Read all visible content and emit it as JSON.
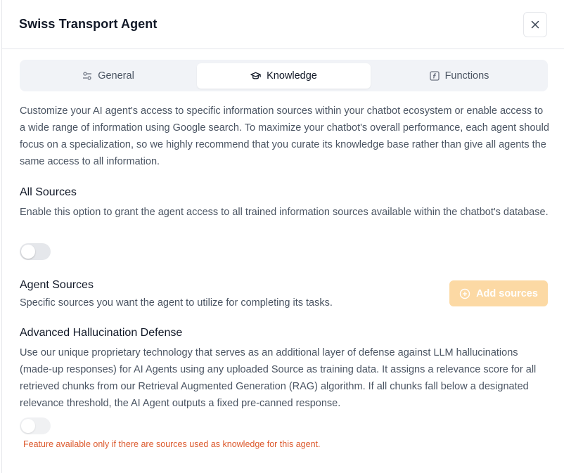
{
  "dialog": {
    "title": "Swiss Transport Agent",
    "close_icon": "close-icon"
  },
  "tabs": [
    {
      "label": "General",
      "icon": "sliders-icon",
      "active": false
    },
    {
      "label": "Knowledge",
      "icon": "graduation-cap-icon",
      "active": true
    },
    {
      "label": "Functions",
      "icon": "function-icon",
      "active": false
    }
  ],
  "intro": "Customize your AI agent's access to specific information sources within your chatbot ecosystem or enable access to a wide range of information using Google search. To maximize your chatbot's overall performance, each agent should focus on a specialization, so we highly recommend that you curate its knowledge base rather than give all agents the same access to all information.",
  "all_sources": {
    "heading": "All Sources",
    "description": "Enable this option to grant the agent access to all trained information sources available within the chatbot's database.",
    "enabled": false
  },
  "agent_sources": {
    "heading": "Agent Sources",
    "description": "Specific sources you want the agent to utilize for completing its tasks.",
    "button_label": "Add sources",
    "button_icon": "plus-circle-icon"
  },
  "hallucination": {
    "heading": "Advanced Hallucination Defense",
    "description": "Use our unique proprietary technology that serves as an additional layer of defense against LLM hallucinations (made-up responses) for AI Agents using any uploaded Source as training data. It assigns a relevance score for all retrieved chunks from our Retrieval Augmented Generation (RAG) algorithm. If all chunks fall below a designated relevance threshold, the AI Agent outputs a fixed pre-canned response.",
    "enabled": false,
    "warning": "Feature available only if there are sources used as knowledge for this agent."
  },
  "colors": {
    "accent_disabled": "#fcd9a4",
    "warning": "#dc5a2e",
    "tab_bg": "#f1f3f7"
  }
}
